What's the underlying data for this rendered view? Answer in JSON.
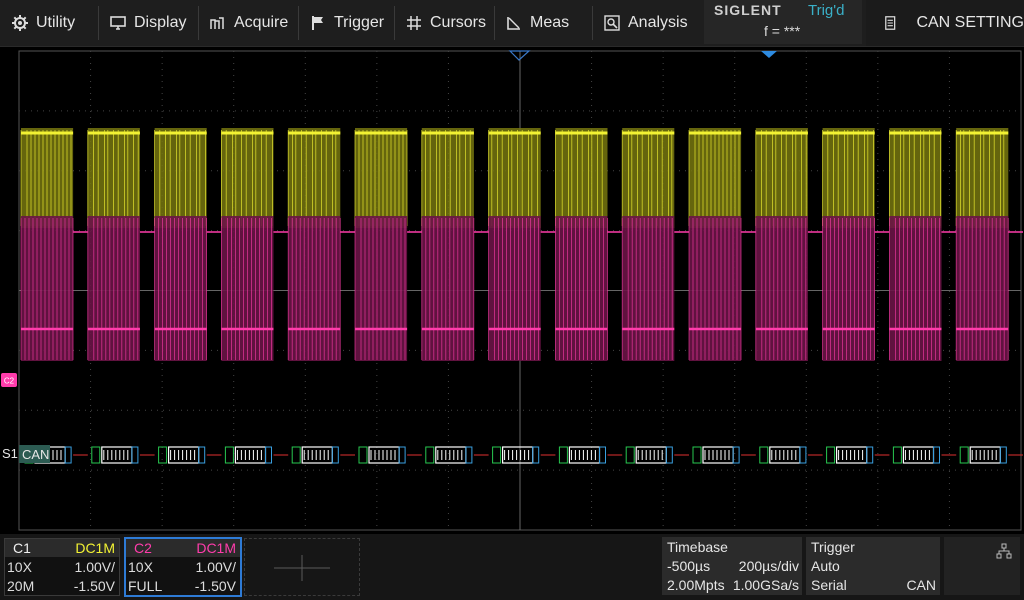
{
  "menu": {
    "items": [
      {
        "label": "Utility",
        "icon": "gear-icon"
      },
      {
        "label": "Display",
        "icon": "monitor-icon"
      },
      {
        "label": "Acquire",
        "icon": "waveform-icon"
      },
      {
        "label": "Trigger",
        "icon": "flag-icon"
      },
      {
        "label": "Cursors",
        "icon": "crosshair-icon"
      },
      {
        "label": "Meas",
        "icon": "ruler-icon"
      },
      {
        "label": "Analysis",
        "icon": "magnifier-icon"
      }
    ]
  },
  "status": {
    "brand": "SIGLENT",
    "trigger_state": "Trig'd",
    "frequency": "f = ***"
  },
  "panel": {
    "title": "CAN SETTING",
    "icon": "document-icon"
  },
  "screen": {
    "colors": {
      "ch1": "#f2f233",
      "ch2": "#ff3cab",
      "grid": "#444444"
    },
    "c2_marker": "C2",
    "decode": {
      "label": "S1",
      "protocol": "CAN",
      "frames": 15
    }
  },
  "channels": {
    "c1": {
      "name": "C1",
      "coupling": "DC1M",
      "probe": "10X",
      "scale": "1.00V/",
      "bandwidth": "20M",
      "offset": "-1.50V",
      "color": "#f2f233"
    },
    "c2": {
      "name": "C2",
      "coupling": "DC1M",
      "probe": "10X",
      "scale": "1.00V/",
      "bandwidth": "FULL",
      "offset": "-1.50V",
      "color": "#ff3cab"
    }
  },
  "timebase": {
    "title": "Timebase",
    "delay": "-500µs",
    "scale": "200µs/div",
    "memory": "2.00Mpts",
    "sample_rate": "1.00GSa/s"
  },
  "trigger": {
    "title": "Trigger",
    "mode": "Auto",
    "type": "Serial",
    "source": "CAN"
  }
}
